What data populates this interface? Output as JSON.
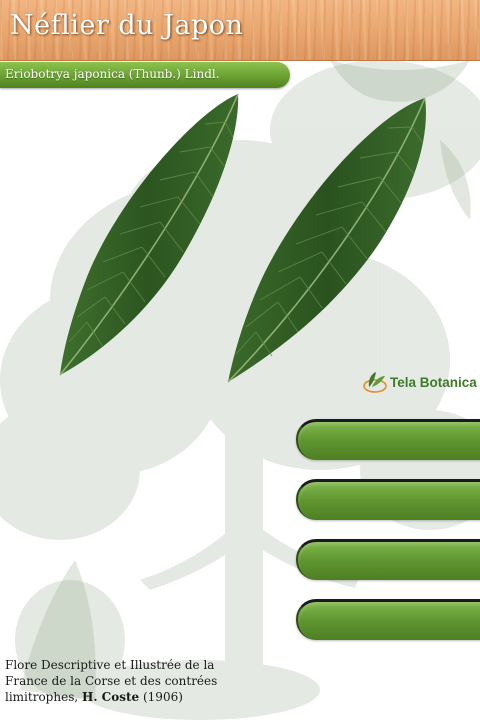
{
  "header": {
    "title": "Néflier du Japon"
  },
  "species": {
    "scientific_name": "Eriobotrya japonica (Thunb.) Lindl."
  },
  "images": {
    "background": "faded-tree-illustration",
    "leaf_left": "loquat-leaf",
    "leaf_right": "loquat-leaf"
  },
  "logo": {
    "text": "Tela Botanica",
    "icon": "tela-botanica-leaf-icon"
  },
  "menu": {
    "buttons": [
      {
        "label": ""
      },
      {
        "label": ""
      },
      {
        "label": ""
      },
      {
        "label": ""
      }
    ]
  },
  "credit": {
    "line_prefix": "Flore Descriptive et Illustrée de la France de la Corse et des contrées limitrophes, ",
    "author": "H. Coste",
    "year": " (1906)"
  },
  "colors": {
    "wood": "#e9a66e",
    "accent_green": "#5f9530",
    "leaf_dark": "#2f5a23",
    "logo_green": "#3f7a2a"
  }
}
